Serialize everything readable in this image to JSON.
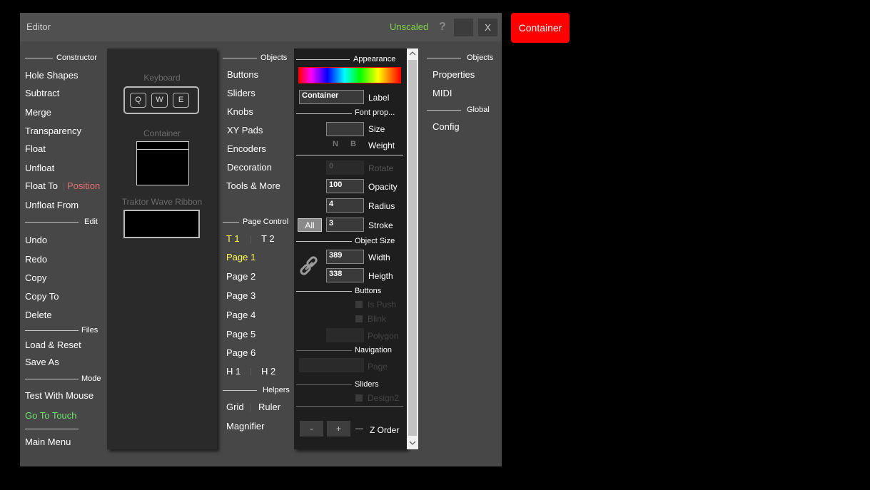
{
  "floating_button": {
    "label": "Container",
    "color": "#ff0000"
  },
  "titlebar": {
    "title": "Editor",
    "status": "Unscaled",
    "help": "?",
    "close": "X"
  },
  "constructor_menu": {
    "section_constructor": "Constructor",
    "hole_shapes": "Hole Shapes",
    "subtract": "Subtract",
    "merge": "Merge",
    "transparency": "Transparency",
    "float": "Float",
    "unfloat": "Unfloat",
    "float_to": "Float To",
    "position": "Position",
    "unfloat_from": "Unfloat From",
    "section_edit": "Edit",
    "undo": "Undo",
    "redo": "Redo",
    "copy": "Copy",
    "copy_to": "Copy To",
    "delete": "Delete",
    "section_files": "Files",
    "load_reset": "Load & Reset",
    "save_as": "Save As",
    "section_mode": "Mode",
    "test_with_mouse": "Test With Mouse",
    "go_to_touch": "Go To Touch",
    "main_menu": "Main Menu"
  },
  "palette": {
    "keyboard_label": "Keyboard",
    "keys": [
      "Q",
      "W",
      "E"
    ],
    "container_label": "Container",
    "wave_label": "Traktor Wave Ribbon"
  },
  "objects_menu": {
    "section_objects": "Objects",
    "buttons": "Buttons",
    "sliders": "Sliders",
    "knobs": "Knobs",
    "xy_pads": "XY Pads",
    "encoders": "Encoders",
    "decoration": "Decoration",
    "tools_more": "Tools & More",
    "section_page_control": "Page Control",
    "t1": "T 1",
    "t2": "T 2",
    "pages": [
      "Page 1",
      "Page 2",
      "Page 3",
      "Page 4",
      "Page 5",
      "Page 6"
    ],
    "h1": "H 1",
    "h2": "H 2",
    "section_helpers": "Helpers",
    "grid": "Grid",
    "ruler": "Ruler",
    "magnifier": "Magnifier"
  },
  "properties": {
    "section_appearance": "Appearance",
    "label_value": "Container",
    "label_caption": "Label",
    "section_font": "Font prop...",
    "size_caption": "Size",
    "weight_n": "N",
    "weight_b": "B",
    "weight_caption": "Weight",
    "rotate_value": "0",
    "rotate_caption": "Rotate",
    "opacity_value": "100",
    "opacity_caption": "Opacity",
    "radius_value": "4",
    "radius_caption": "Radius",
    "all_button": "All",
    "stroke_value": "3",
    "stroke_caption": "Stroke",
    "section_object_size": "Object Size",
    "width_value": "389",
    "width_caption": "Width",
    "height_value": "338",
    "height_caption": "Heigth",
    "section_buttons": "Buttons",
    "is_push": "Is Push",
    "blink": "Blink",
    "polygon": "Polygon",
    "section_navigation": "Navigation",
    "page": "Page",
    "section_sliders": "Sliders",
    "design2": "Design2",
    "minus": "-",
    "plus": "+",
    "dash": "—",
    "z_order": "Z Order"
  },
  "right_menu": {
    "section_objects": "Objects",
    "properties": "Properties",
    "midi": "MIDI",
    "section_global": "Global",
    "config": "Config"
  },
  "colors": {
    "accent_green": "#7fd34e",
    "highlight_yellow": "#ffff4d",
    "position_red": "#e07070",
    "touch_green": "#6ee06e"
  }
}
